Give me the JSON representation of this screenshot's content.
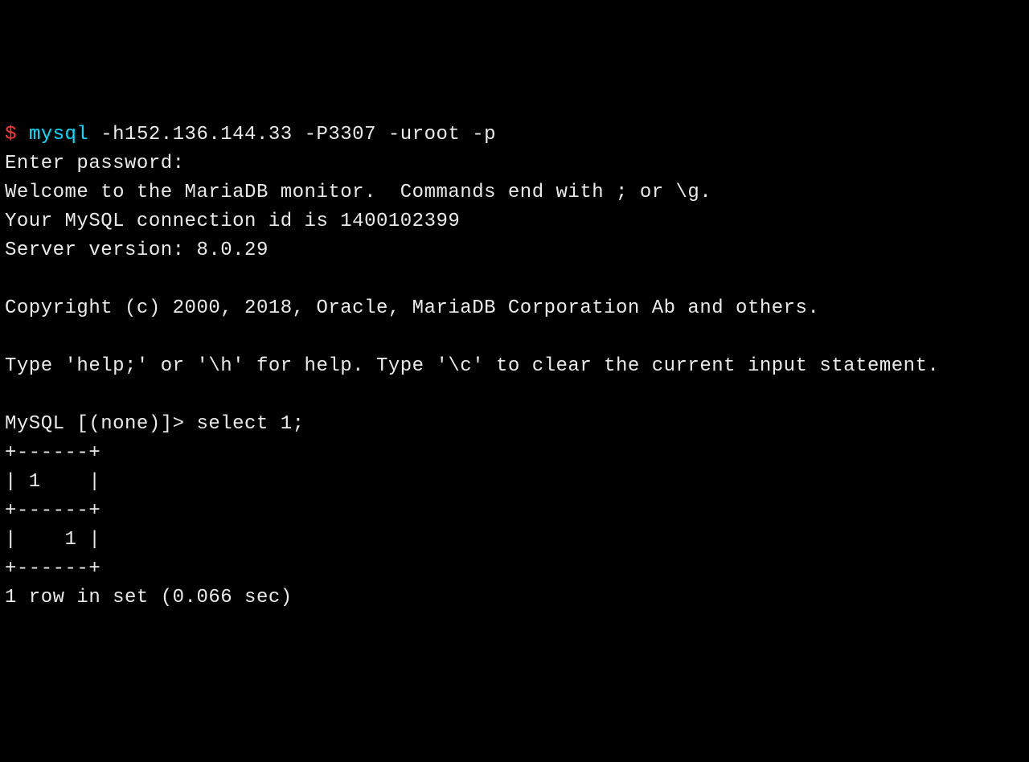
{
  "shell_prompt": "$",
  "command_name": "mysql",
  "command_args": " -h152.136.144.33 -P3307 -uroot -p",
  "enter_password": "Enter password:",
  "welcome": "Welcome to the MariaDB monitor.  Commands end with ; or \\g.",
  "conn_id_line": "Your MySQL connection id is 1400102399",
  "server_version_line": "Server version: 8.0.29",
  "copyright_line": "Copyright (c) 2000, 2018, Oracle, MariaDB Corporation Ab and others.",
  "help_line": "Type 'help;' or '\\h' for help. Type '\\c' to clear the current input statement.",
  "mysql_prompt": "MySQL [(none)]> ",
  "query": "select 1;",
  "table_border": "+------+",
  "table_header_row": "| 1    |",
  "table_data_row": "|    1 |",
  "summary": "1 row in set (0.066 sec)"
}
